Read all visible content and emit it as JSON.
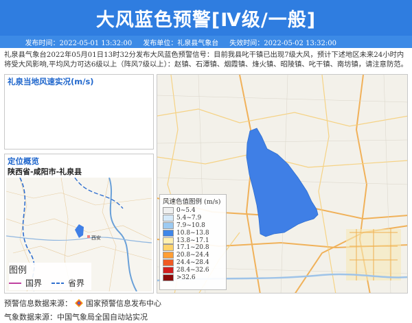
{
  "banner": {
    "title": "大风蓝色预警[Ⅳ级/一般]"
  },
  "meta": {
    "publish_time": "发布时间：2022-05-01 13:32:00",
    "publisher": "发布单位：礼泉县气象台",
    "expire_time": "失效时间：2022-05-02 13:32:00"
  },
  "description": "礼泉县气象台2022年05月01日13时32分发布大风蓝色预警信号：目前我县叱干镇已出现7级大风，预计下述地区未来24小时内将受大风影响,平均风力可达6级以上（阵风7级以上）：赵镇、石潭镇、烟霞镇、烽火镇、昭陵镇、叱干镇、南坊镇，请注意防范。",
  "wind_panel": {
    "title": "礼泉当地风速实况(m/s)"
  },
  "location_panel": {
    "title": "定位概览",
    "subtitle": "陕西省-咸阳市-礼泉县",
    "city_label": "西安"
  },
  "small_legend": {
    "title": "图例",
    "items": [
      "国界",
      "省界"
    ]
  },
  "map_legend": {
    "title": "风速色值图例 (m/s)",
    "items": [
      {
        "label": "0~5.4",
        "color": "#f0f0f0"
      },
      {
        "label": "5.4~7.9",
        "color": "#d6eafa"
      },
      {
        "label": "7.9~10.8",
        "color": "#9ccaf2"
      },
      {
        "label": "10.8~13.8",
        "color": "#3f86e8"
      },
      {
        "label": "13.8~17.1",
        "color": "#fff0b0"
      },
      {
        "label": "17.1~20.8",
        "color": "#ffd36a"
      },
      {
        "label": "20.8~24.4",
        "color": "#ff9e35"
      },
      {
        "label": "24.4~28.4",
        "color": "#f05a24"
      },
      {
        "label": "28.4~32.6",
        "color": "#d21e1e"
      },
      {
        "label": ">32.6",
        "color": "#8c0a0a"
      }
    ]
  },
  "footer": {
    "warning_source": "预警信息数据来源：",
    "warning_source_name": "国家预警信息发布中心",
    "weather_source": "气象数据来源：中国气象局全国自动站实况"
  },
  "colors": {
    "banner": "#2f7de0",
    "county_fill": "#3f7fe6",
    "title_blue": "#1f66cc"
  }
}
